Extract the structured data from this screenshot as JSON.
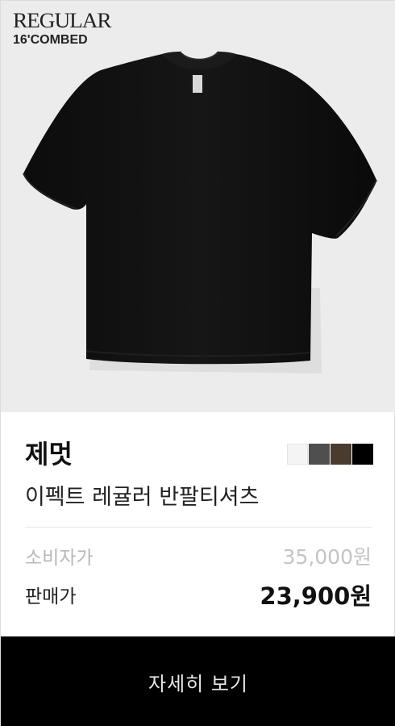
{
  "hero": {
    "brand_title": "REGULAR",
    "brand_subtitle": "16'COMBED",
    "image_icon": "black-tshirt-icon"
  },
  "product": {
    "brand": "제멋",
    "name": "이펙트 레귤러 반팔티셔츠",
    "swatches": [
      {
        "name": "white",
        "color": "#f4f4f4"
      },
      {
        "name": "charcoal",
        "color": "#4f4f4f"
      },
      {
        "name": "brown",
        "color": "#4b3a2e"
      },
      {
        "name": "black",
        "color": "#000000"
      }
    ]
  },
  "pricing": {
    "msrp_label": "소비자가",
    "msrp_value": "35,000원",
    "sale_label": "판매가",
    "sale_value": "23,900원"
  },
  "cta": {
    "label": "자세히 보기"
  }
}
